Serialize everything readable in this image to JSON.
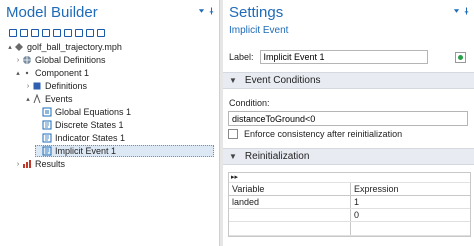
{
  "model_builder": {
    "title": "Model Builder",
    "tree": [
      {
        "label": "golf_ball_trajectory.mph",
        "icon": "root-model-icon",
        "expand": "▴"
      },
      {
        "label": "Global Definitions",
        "icon": "global-definitions-icon",
        "expand": "›"
      },
      {
        "label": "Component 1",
        "icon": "component-icon",
        "expand": "▴"
      },
      {
        "label": "Definitions",
        "icon": "definitions-icon",
        "expand": "›"
      },
      {
        "label": "Events",
        "icon": "events-icon",
        "expand": "▴"
      },
      {
        "label": "Global Equations 1",
        "icon": "global-equations-icon",
        "expand": ""
      },
      {
        "label": "Discrete States 1",
        "icon": "discrete-states-icon",
        "expand": ""
      },
      {
        "label": "Indicator States 1",
        "icon": "indicator-states-icon",
        "expand": ""
      },
      {
        "label": "Implicit Event 1",
        "icon": "implicit-event-icon",
        "expand": ""
      },
      {
        "label": "Results",
        "icon": "results-icon",
        "expand": "›"
      }
    ]
  },
  "settings": {
    "title": "Settings",
    "subtitle": "Implicit Event",
    "label_caption": "Label:",
    "label_value": "Implicit Event 1",
    "event_conditions_header": "Event Conditions",
    "condition_caption": "Condition:",
    "condition_value": "distanceToGround<0",
    "enforce_label": "Enforce consistency after reinitialization",
    "reinit_header": "Reinitialization",
    "table_toolbar": "▸▸",
    "table_headers": [
      "Variable",
      "Expression"
    ],
    "table_rows": [
      [
        "landed",
        "1"
      ],
      [
        "",
        "0"
      ]
    ]
  },
  "colors": {
    "accent": "#1e6bb8",
    "section_bg": "#e8ecf2",
    "selection_bg": "#dde8f5"
  }
}
